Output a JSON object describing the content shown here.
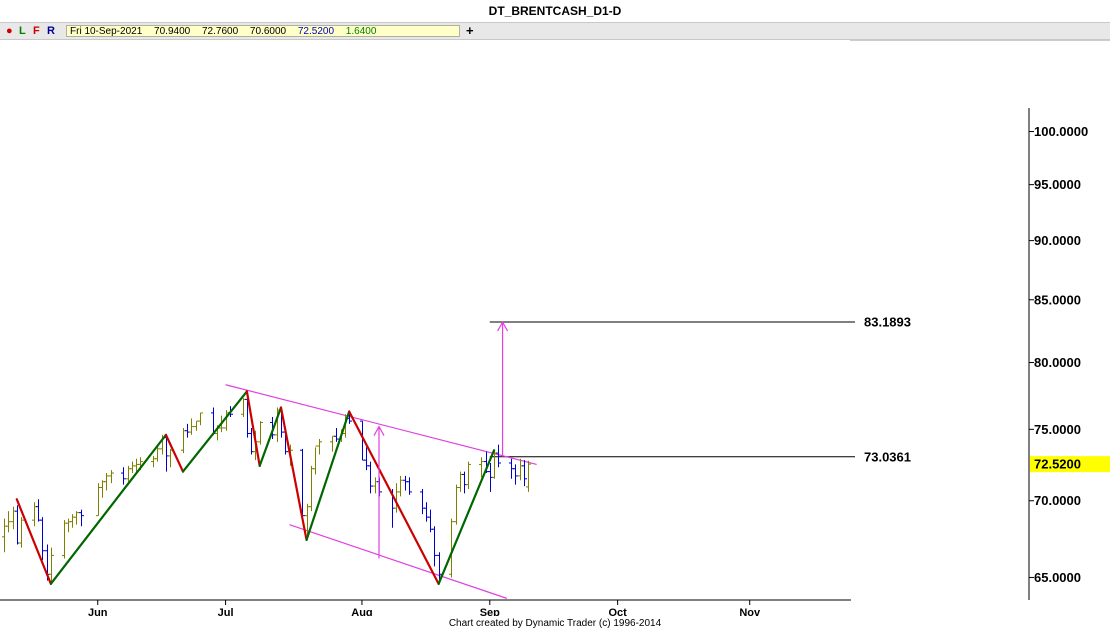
{
  "window": {
    "title": "DT_BRENTCASH_D1-D"
  },
  "toolbar": {
    "dot_icon": "red-dot-icon",
    "buttons": [
      {
        "label": "L",
        "color": "#008000"
      },
      {
        "label": "F",
        "color": "#cc0000"
      },
      {
        "label": "R",
        "color": "#000099"
      }
    ],
    "ohlc": {
      "date": "Fri 10-Sep-2021",
      "open": "70.9400",
      "high": "72.7600",
      "low": "70.6000",
      "close": "72.5200",
      "change": "1.6400"
    },
    "plus_label": "+"
  },
  "footer": {
    "credit": "Chart created by Dynamic Trader  (c) 1996-2014"
  },
  "chart_data": {
    "type": "bar",
    "subtype": "ohlc",
    "yscale": "log",
    "ylim": [
      63.6,
      102.3
    ],
    "price_axis_ticks": [
      "100.0000",
      "95.0000",
      "90.0000",
      "85.0000",
      "80.0000",
      "75.0000",
      "70.0000",
      "65.0000"
    ],
    "current_price_label": "72.5200",
    "date_labels": [
      {
        "label": "Jun",
        "date": "2021-06-01"
      },
      {
        "label": "Jul",
        "date": "2021-07-01"
      },
      {
        "label": "Aug",
        "date": "2021-08-02"
      },
      {
        "label": "Sep",
        "date": "2021-09-01"
      },
      {
        "label": "Oct",
        "date": "2021-10-01"
      },
      {
        "label": "Nov",
        "date": "2021-11-01"
      }
    ],
    "xlim": [
      "2021-05-10",
      "2021-11-25"
    ],
    "bar_colors": {
      "up": "#808000",
      "down": "#0000cc"
    },
    "bars": [
      [
        "2021-05-10",
        67.6,
        68.8,
        66.6,
        68.3
      ],
      [
        "2021-05-11",
        68.3,
        69.3,
        67.9,
        68.6
      ],
      [
        "2021-05-12",
        68.6,
        69.6,
        68.1,
        69.3
      ],
      [
        "2021-05-13",
        69.3,
        69.7,
        67.1,
        67.2
      ],
      [
        "2021-05-14",
        67.2,
        68.9,
        66.9,
        68.7
      ],
      [
        "2021-05-17",
        68.7,
        69.9,
        68.3,
        69.6
      ],
      [
        "2021-05-18",
        69.6,
        70.1,
        68.6,
        68.7
      ],
      [
        "2021-05-19",
        68.7,
        68.9,
        66.1,
        66.7
      ],
      [
        "2021-05-20",
        66.7,
        67.1,
        64.8,
        65.2
      ],
      [
        "2021-05-21",
        65.2,
        66.9,
        64.6,
        66.4
      ],
      [
        "2021-05-24",
        66.4,
        68.7,
        66.2,
        68.5
      ],
      [
        "2021-05-25",
        68.5,
        68.8,
        67.9,
        68.6
      ],
      [
        "2021-05-26",
        68.6,
        69.1,
        68.2,
        68.9
      ],
      [
        "2021-05-27",
        68.9,
        69.3,
        68.4,
        69.2
      ],
      [
        "2021-05-28",
        69.2,
        69.4,
        68.3,
        69.0
      ],
      [
        "2021-06-01",
        69.0,
        71.2,
        69.0,
        70.9
      ],
      [
        "2021-06-02",
        70.9,
        71.4,
        70.2,
        71.3
      ],
      [
        "2021-06-03",
        71.3,
        71.9,
        70.7,
        71.7
      ],
      [
        "2021-06-04",
        71.7,
        72.1,
        71.2,
        71.9
      ],
      [
        "2021-06-07",
        71.9,
        72.3,
        71.1,
        71.5
      ],
      [
        "2021-06-08",
        71.5,
        72.4,
        71.3,
        72.2
      ],
      [
        "2021-06-09",
        72.2,
        72.7,
        71.9,
        72.4
      ],
      [
        "2021-06-10",
        72.4,
        72.9,
        71.9,
        72.5
      ],
      [
        "2021-06-11",
        72.5,
        73.0,
        72.1,
        72.7
      ],
      [
        "2021-06-14",
        72.7,
        73.1,
        72.3,
        72.9
      ],
      [
        "2021-06-15",
        72.9,
        73.8,
        72.7,
        73.6
      ],
      [
        "2021-06-16",
        73.6,
        74.6,
        73.2,
        74.4
      ],
      [
        "2021-06-17",
        74.4,
        74.6,
        72.0,
        73.1
      ],
      [
        "2021-06-18",
        73.1,
        73.6,
        72.3,
        73.5
      ],
      [
        "2021-06-21",
        73.5,
        75.1,
        73.3,
        74.9
      ],
      [
        "2021-06-22",
        74.9,
        75.4,
        74.4,
        74.8
      ],
      [
        "2021-06-23",
        74.8,
        75.8,
        74.6,
        75.2
      ],
      [
        "2021-06-24",
        75.2,
        75.6,
        74.9,
        75.6
      ],
      [
        "2021-06-25",
        75.6,
        76.2,
        75.3,
        76.2
      ],
      [
        "2021-06-28",
        76.2,
        76.6,
        74.6,
        74.7
      ],
      [
        "2021-06-29",
        74.7,
        75.3,
        74.2,
        75.1
      ],
      [
        "2021-06-30",
        75.1,
        76.0,
        74.8,
        75.1
      ],
      [
        "2021-07-01",
        75.1,
        76.4,
        74.9,
        76.2
      ],
      [
        "2021-07-02",
        76.2,
        76.7,
        75.9,
        76.1
      ],
      [
        "2021-07-05",
        76.1,
        77.3,
        75.9,
        77.2
      ],
      [
        "2021-07-06",
        77.2,
        77.8,
        74.4,
        74.7
      ],
      [
        "2021-07-07",
        74.7,
        75.1,
        73.2,
        73.4
      ],
      [
        "2021-07-08",
        73.4,
        74.9,
        72.8,
        74.1
      ],
      [
        "2021-07-09",
        74.1,
        75.6,
        73.9,
        75.5
      ],
      [
        "2021-07-12",
        75.5,
        75.9,
        74.3,
        74.6
      ],
      [
        "2021-07-13",
        74.6,
        76.6,
        74.1,
        76.4
      ],
      [
        "2021-07-14",
        76.4,
        76.6,
        74.4,
        74.8
      ],
      [
        "2021-07-15",
        74.8,
        75.0,
        73.2,
        73.4
      ],
      [
        "2021-07-16",
        73.4,
        73.9,
        72.4,
        73.5
      ],
      [
        "2021-07-19",
        73.5,
        73.6,
        68.6,
        69.0
      ],
      [
        "2021-07-20",
        69.0,
        69.8,
        67.4,
        69.6
      ],
      [
        "2021-07-21",
        69.6,
        72.4,
        69.3,
        72.2
      ],
      [
        "2021-07-22",
        72.2,
        73.7,
        71.8,
        73.8
      ],
      [
        "2021-07-23",
        73.8,
        74.3,
        73.2,
        74.1
      ],
      [
        "2021-07-26",
        74.1,
        74.5,
        73.4,
        74.5
      ],
      [
        "2021-07-27",
        74.5,
        75.1,
        74.1,
        74.3
      ],
      [
        "2021-07-28",
        74.3,
        75.0,
        74.1,
        74.7
      ],
      [
        "2021-07-29",
        74.7,
        76.1,
        74.4,
        75.8
      ],
      [
        "2021-07-30",
        75.8,
        76.3,
        75.4,
        75.6
      ],
      [
        "2021-08-02",
        75.6,
        75.6,
        72.8,
        72.8
      ],
      [
        "2021-08-03",
        72.8,
        73.7,
        72.1,
        72.4
      ],
      [
        "2021-08-04",
        72.4,
        72.7,
        70.5,
        71.0
      ],
      [
        "2021-08-05",
        71.0,
        71.6,
        70.5,
        71.3
      ],
      [
        "2021-08-06",
        71.3,
        71.6,
        70.3,
        70.6
      ],
      [
        "2021-08-09",
        70.6,
        70.8,
        68.2,
        69.5
      ],
      [
        "2021-08-10",
        69.5,
        71.2,
        69.2,
        70.6
      ],
      [
        "2021-08-11",
        70.6,
        71.7,
        70.3,
        71.4
      ],
      [
        "2021-08-12",
        71.4,
        71.7,
        70.7,
        71.3
      ],
      [
        "2021-08-13",
        71.3,
        71.6,
        70.4,
        70.6
      ],
      [
        "2021-08-16",
        70.6,
        70.8,
        69.1,
        69.5
      ],
      [
        "2021-08-17",
        69.5,
        69.9,
        68.6,
        68.9
      ],
      [
        "2021-08-18",
        68.9,
        69.4,
        67.9,
        68.1
      ],
      [
        "2021-08-19",
        68.1,
        68.3,
        65.7,
        66.4
      ],
      [
        "2021-08-20",
        66.4,
        66.6,
        64.6,
        65.2
      ],
      [
        "2021-08-23",
        65.2,
        68.8,
        65.0,
        68.6
      ],
      [
        "2021-08-24",
        68.6,
        71.1,
        68.4,
        70.9
      ],
      [
        "2021-08-25",
        70.9,
        72.0,
        70.6,
        71.8
      ],
      [
        "2021-08-26",
        71.8,
        72.0,
        70.5,
        71.1
      ],
      [
        "2021-08-27",
        71.1,
        72.7,
        70.8,
        72.5
      ],
      [
        "2021-08-30",
        72.5,
        73.0,
        71.6,
        72.7
      ],
      [
        "2021-08-31",
        72.7,
        73.4,
        71.9,
        72.0
      ],
      [
        "2021-09-01",
        72.0,
        72.6,
        70.6,
        71.6
      ],
      [
        "2021-09-02",
        71.6,
        73.5,
        71.5,
        73.3
      ],
      [
        "2021-09-03",
        73.3,
        73.9,
        72.3,
        72.6
      ],
      [
        "2021-09-06",
        72.6,
        72.9,
        71.5,
        72.2
      ],
      [
        "2021-09-07",
        72.2,
        72.5,
        71.1,
        71.7
      ],
      [
        "2021-09-08",
        71.7,
        72.9,
        71.4,
        72.4
      ],
      [
        "2021-09-09",
        72.4,
        72.8,
        71.0,
        71.5
      ],
      [
        "2021-09-10",
        70.94,
        72.76,
        70.6,
        72.52
      ]
    ],
    "swing_lines": [
      {
        "color": "#cc0000",
        "points": [
          [
            "2021-05-13",
            70.1
          ],
          [
            "2021-05-21",
            64.6
          ]
        ]
      },
      {
        "color": "#006600",
        "points": [
          [
            "2021-05-21",
            64.6
          ],
          [
            "2021-06-17",
            74.6
          ]
        ]
      },
      {
        "color": "#cc0000",
        "points": [
          [
            "2021-06-17",
            74.6
          ],
          [
            "2021-06-21",
            72.0
          ]
        ]
      },
      {
        "color": "#006600",
        "points": [
          [
            "2021-06-21",
            72.0
          ],
          [
            "2021-07-06",
            77.8
          ]
        ]
      },
      {
        "color": "#cc0000",
        "points": [
          [
            "2021-07-06",
            77.8
          ],
          [
            "2021-07-09",
            72.4
          ]
        ]
      },
      {
        "color": "#006600",
        "points": [
          [
            "2021-07-09",
            72.4
          ],
          [
            "2021-07-14",
            76.6
          ]
        ]
      },
      {
        "color": "#cc0000",
        "points": [
          [
            "2021-07-14",
            76.6
          ],
          [
            "2021-07-20",
            67.4
          ]
        ]
      },
      {
        "color": "#006600",
        "points": [
          [
            "2021-07-20",
            67.4
          ],
          [
            "2021-07-30",
            76.3
          ]
        ]
      },
      {
        "color": "#cc0000",
        "points": [
          [
            "2021-07-30",
            76.3
          ],
          [
            "2021-08-20",
            64.6
          ]
        ]
      },
      {
        "color": "#006600",
        "points": [
          [
            "2021-08-20",
            64.6
          ],
          [
            "2021-09-02",
            73.5
          ]
        ]
      }
    ],
    "channel_lines": [
      {
        "color": "#e040e0",
        "points": [
          [
            "2021-07-01",
            78.3
          ],
          [
            "2021-09-12",
            72.5
          ]
        ]
      },
      {
        "color": "#e040e0",
        "points": [
          [
            "2021-07-16",
            68.4
          ],
          [
            "2021-09-05",
            63.7
          ]
        ]
      }
    ],
    "projection_arrows": [
      {
        "color": "#e040e0",
        "date": "2021-08-06",
        "from": 66.2,
        "to": 75.2
      },
      {
        "color": "#e040e0",
        "date": "2021-09-04",
        "from": 73.04,
        "to": 83.19
      }
    ],
    "horizontal_levels": [
      {
        "value": 83.1893,
        "label": "83.1893",
        "from": "2021-09-01"
      },
      {
        "value": 73.0361,
        "label": "73.0361",
        "from": "2021-09-01"
      }
    ]
  }
}
